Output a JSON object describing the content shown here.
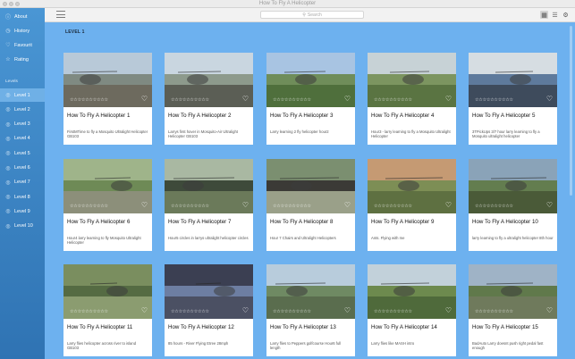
{
  "window": {
    "title": "How To Fly A Helicopter"
  },
  "sidebar": {
    "items": [
      {
        "label": "About",
        "icon": "info-icon"
      },
      {
        "label": "History",
        "icon": "clock-icon"
      },
      {
        "label": "Favourit",
        "icon": "heart-icon"
      },
      {
        "label": "Rating",
        "icon": "star-icon"
      }
    ],
    "section_label": "Levels",
    "levels": [
      "Level 1",
      "Level 2",
      "Level 3",
      "Level 4",
      "Level 5",
      "Level 6",
      "Level 7",
      "Level 8",
      "Level 9",
      "Level 10"
    ],
    "active_level": "Level 1"
  },
  "toolbar": {
    "search_placeholder": "Search",
    "view_icons": [
      "grid-view-icon",
      "list-view-icon",
      "settings-icon"
    ]
  },
  "main": {
    "heading": "LEVEL 1",
    "rating_stars": "☆☆☆☆☆☆☆☆☆☆",
    "cards": [
      {
        "title": "How To Fly A Helicopter 1",
        "desc": "FirstMTime to fly a Mosquito Ultralight Helicopter GB103"
      },
      {
        "title": "How To Fly A Helicopter 2",
        "desc": "Larrys first hover in Mosquito-Air Ultralight Helicopter GB103"
      },
      {
        "title": "How To Fly A Helicopter 3",
        "desc": "Larry learning 2 fly helicopter hour2"
      },
      {
        "title": "How To Fly A Helicopter 4",
        "desc": "Hour3 - larry learning to fly a Mosquito Ultralight Helicopter"
      },
      {
        "title": "How To Fly A Helicopter 5",
        "desc": "3TPickUps 3/7 hour larry learning to fly a Mosquito ultralight helicopter"
      },
      {
        "title": "How To Fly A Helicopter 6",
        "desc": "Hour4 larry learning to fly Mosquito Ultralight Helicopter"
      },
      {
        "title": "How To Fly A Helicopter 7",
        "desc": "Hour5 circles in larrys ultralight helicopter circles"
      },
      {
        "title": "How To Fly A Helicopter 8",
        "desc": "Hour 7 Chairs and Ultralight Helicopters"
      },
      {
        "title": "How To Fly A Helicopter 9",
        "desc": "Ants. Flying with me"
      },
      {
        "title": "How To Fly A Helicopter 10",
        "desc": "larry learning to fly a ultralight helicopter 8th hour"
      },
      {
        "title": "How To Fly A Helicopter 11",
        "desc": "Larry flies helicopter across river to island GB103"
      },
      {
        "title": "How To Fly A Helicopter 12",
        "desc": "85 hours - River Flying Etree 28mph"
      },
      {
        "title": "How To Fly A Helicopter 13",
        "desc": "Larry flies to Peppers golfcourse Hour6 full length"
      },
      {
        "title": "How To Fly A Helicopter 14",
        "desc": "Larry flies like MASH intro"
      },
      {
        "title": "How To Fly A Helicopter 15",
        "desc": "BadAuto Larry doesnt push right pedal fast enough"
      }
    ]
  },
  "colors": {
    "sidebar": "#3b84c5",
    "sidebar_active": "#6fb0e6",
    "content_bg": "#6db1ef"
  }
}
